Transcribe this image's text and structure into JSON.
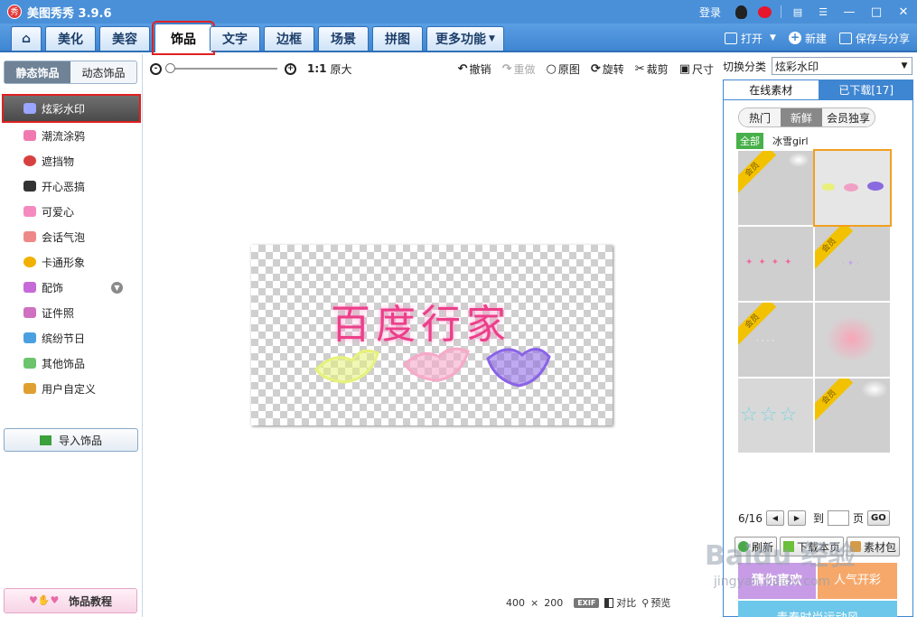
{
  "app": {
    "logo": "秀",
    "title": "美图秀秀 3.9.6",
    "login": "登录"
  },
  "tabs": [
    {
      "label": "美化"
    },
    {
      "label": "美容"
    },
    {
      "label": "饰品"
    },
    {
      "label": "文字"
    },
    {
      "label": "边框"
    },
    {
      "label": "场景"
    },
    {
      "label": "拼图"
    },
    {
      "label": "更多功能"
    }
  ],
  "actions": {
    "open": "打开",
    "new": "新建",
    "save_share": "保存与分享"
  },
  "left": {
    "segment": [
      "静态饰品",
      "动态饰品"
    ],
    "categories": [
      "炫彩水印",
      "潮流涂鸦",
      "遮挡物",
      "开心恶搞",
      "可爱心",
      "会话气泡",
      "卡通形象",
      "配饰",
      "证件照",
      "缤纷节日",
      "其他饰品",
      "用户自定义"
    ],
    "import": "导入饰品",
    "tutorial": "饰品教程"
  },
  "toolbar": {
    "ratio": "1:1",
    "original_size": "原大",
    "undo": "撤销",
    "redo": "重做",
    "original": "原图",
    "rotate": "旋转",
    "crop": "裁剪",
    "resize": "尺寸"
  },
  "canvas": {
    "watermark_text": "百度行家",
    "width": "400",
    "times": "×",
    "height": "200",
    "exif": "EXIF",
    "compare": "对比",
    "preview": "预览"
  },
  "right": {
    "switch_label": "切换分类",
    "category_value": "炫彩水印",
    "tab_online": "在线素材",
    "tab_downloaded": "已下载[17]",
    "filters": [
      "热门",
      "新鲜",
      "会员独享"
    ],
    "tag_all": "全部",
    "tag_author": "冰雪girl",
    "member_badge": "会员",
    "page_current": "6/16",
    "page_go_label": "到",
    "page_unit": "页",
    "go": "GO",
    "refresh": "刷新",
    "download_page": "下载本页",
    "material_pack": "素材包",
    "banner1": "猜你喜欢",
    "banner2": "人气开彩",
    "banner3": "青春时尚运动风"
  },
  "watermark": {
    "brand": "Baidu 经验",
    "url": "jingyan.baidu.com"
  }
}
